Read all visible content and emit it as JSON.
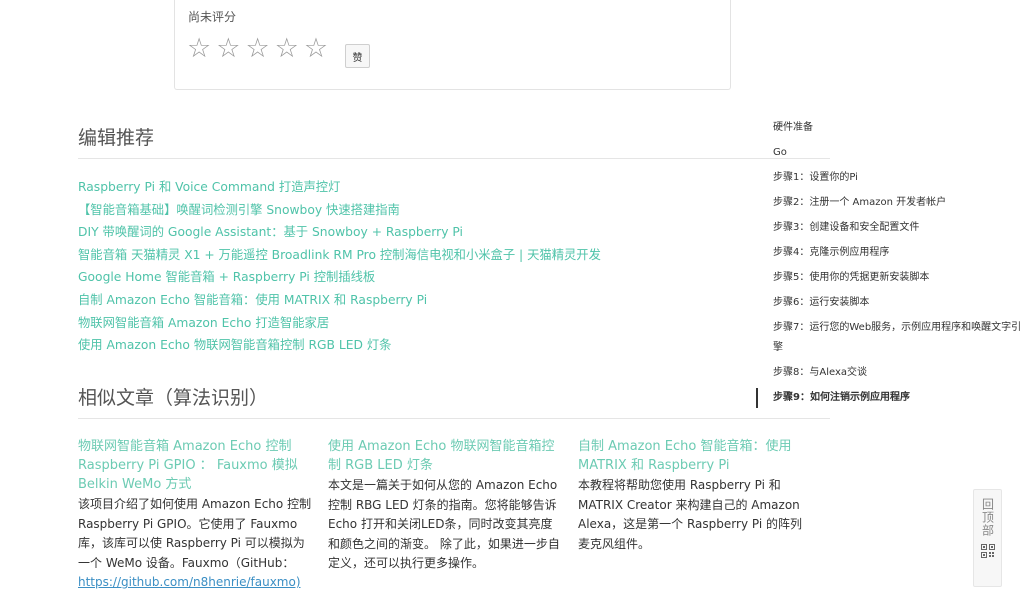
{
  "rating": {
    "label": "尚未评分",
    "stars": [
      "☆",
      "☆",
      "☆",
      "☆",
      "☆"
    ],
    "like_label": "赞"
  },
  "editor": {
    "title": "编辑推荐",
    "links": [
      "Raspberry Pi 和 Voice Command 打造声控灯",
      "【智能音箱基础】唤醒词检测引擎 Snowboy 快速搭建指南",
      "DIY 带唤醒词的 Google Assistant：基于 Snowboy + Raspberry Pi",
      "智能音箱 天猫精灵 X1 + 万能遥控 Broadlink RM Pro 控制海信电视和小米盒子 | 天猫精灵开发",
      "Google Home 智能音箱 + Raspberry Pi 控制插线板",
      "自制 Amazon Echo 智能音箱：使用 MATRIX 和 Raspberry Pi",
      "物联网智能音箱 Amazon Echo 打造智能家居",
      "使用 Amazon Echo 物联网智能音箱控制 RGB LED 灯条"
    ]
  },
  "similar": {
    "title": "相似文章（算法识别）",
    "articles": [
      {
        "title": "物联网智能音箱 Amazon Echo 控制 Raspberry Pi GPIO ： Fauxmo 模拟 Belkin WeMo 方式",
        "desc": "该项目介绍了如何使用 Amazon Echo 控制 Raspberry Pi GPIO。它使用了 Fauxmo 库，该库可以使 Raspberry Pi 可以模拟为一个 WeMo 设备。Fauxmo（GitHub：",
        "link": "https://github.com/n8henrie/fauxmo)"
      },
      {
        "title": "使用 Amazon Echo 物联网智能音箱控制 RGB LED 灯条",
        "desc": "本文是一篇关于如何从您的 Amazon Echo 控制 RBG LED 灯条的指南。您将能够告诉 Echo 打开和关闭LED条，同时改变其亮度和颜色之间的渐变。 除了此，如果进一步自定义，还可以执行更多操作。"
      },
      {
        "title": "自制 Amazon Echo 智能音箱：使用 MATRIX 和 Raspberry Pi",
        "desc": "本教程将帮助您使用 Raspberry Pi 和 MATRIX Creator 来构建自己的 Amazon Alexa，这是第一个 Raspberry Pi 的阵列麦克风组件。"
      }
    ]
  },
  "toc": {
    "items": [
      "硬件准备",
      "Go",
      "步骤1：设置你的Pi",
      "步骤2：注册一个 Amazon 开发者帐户",
      "步骤3：创建设备和安全配置文件",
      "步骤4：克隆示例应用程序",
      "步骤5：使用你的凭据更新安装脚本",
      "步骤6：运行安装脚本",
      "步骤7：运行您的Web服务，示例应用程序和唤醒文字引擎",
      "步骤8：与Alexa交谈",
      "步骤9：如何注销示例应用程序"
    ],
    "active_index": 10
  },
  "back_top": {
    "label": "回顶部"
  },
  "colors": {
    "link": "#4fc3a9",
    "article_title": "#6ccbb3",
    "github_link": "#3b8fc4"
  }
}
